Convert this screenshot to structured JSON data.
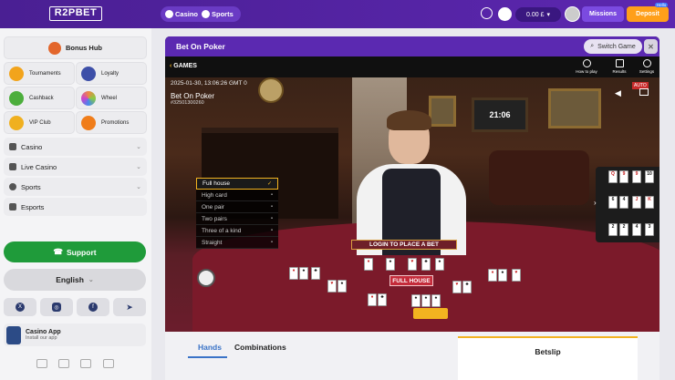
{
  "header": {
    "logo": "R2PBET",
    "nav": [
      "Casino",
      "Sports"
    ],
    "balance": "0.00 £",
    "missions": "Missions",
    "deposit": "Deposit",
    "hello_badge": "Hello",
    "colors": {
      "bar": "#4a1f93",
      "deposit": "#ff9f1a"
    }
  },
  "sidebar": {
    "bonus_hub": "Bonus Hub",
    "tiles": [
      "Tournaments",
      "Loyalty",
      "Cashback",
      "Wheel",
      "VIP Club",
      "Promotions"
    ],
    "nav": [
      "Casino",
      "Live Casino",
      "Sports",
      "Esports"
    ],
    "support": "Support",
    "language": "English",
    "social": [
      "X",
      "Instagram",
      "Facebook",
      "Telegram"
    ],
    "app_title": "Casino App",
    "app_subtitle": "Install our app"
  },
  "game": {
    "title": "Bet On Poker",
    "switch": "Switch Game",
    "back": "GAMES",
    "tools": [
      "How to play",
      "Results",
      "Settings"
    ],
    "date": "2025-01-30, 13:06:26 GMT 0",
    "name": "Bet On Poker",
    "id": "#32501300260",
    "auto": "AUTO",
    "clock": "21:06",
    "hands": [
      "Full house",
      "High card",
      "One pair",
      "Two pairs",
      "Three of a kind",
      "Straight"
    ],
    "login_banner": "LOGIN TO PLACE A BET",
    "result": "FULL HOUSE"
  },
  "bottom": {
    "tabs": [
      "Hands",
      "Combinations"
    ],
    "betslip": "Betslip"
  }
}
